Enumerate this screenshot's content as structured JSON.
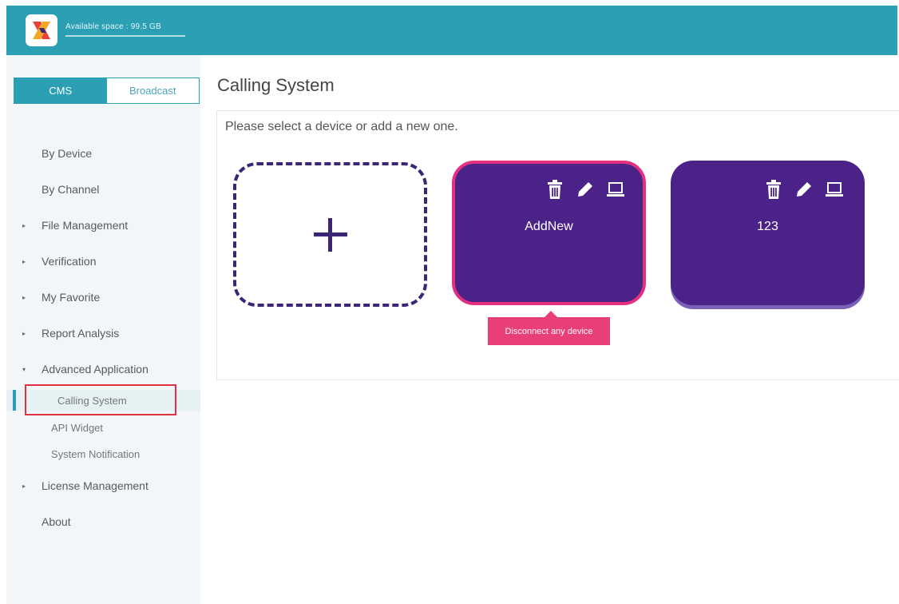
{
  "header": {
    "available_space": "Available space : 99.5 GB",
    "logo": "app-logo-icon",
    "colors": {
      "bar": "#2b9fb3"
    }
  },
  "sidebar": {
    "mode_tabs": [
      {
        "label": "CMS",
        "active": true
      },
      {
        "label": "Broadcast",
        "active": false
      }
    ],
    "items": [
      {
        "label": "By Device"
      },
      {
        "label": "By Channel"
      },
      {
        "label": "File Management",
        "icon": "caret-right-icon"
      },
      {
        "label": "Verification",
        "icon": "caret-right-icon"
      },
      {
        "label": "My Favorite",
        "icon": "caret-right-icon"
      },
      {
        "label": "Report Analysis",
        "icon": "caret-right-icon"
      },
      {
        "label": "Advanced Application",
        "icon": "caret-down-icon",
        "expanded": true
      },
      {
        "label": "License Management",
        "icon": "caret-right-icon"
      },
      {
        "label": "About"
      }
    ],
    "subitems": [
      {
        "label": "Calling System",
        "active": true
      },
      {
        "label": "API Widget"
      },
      {
        "label": "System Notification"
      }
    ],
    "caret_right": "▸",
    "caret_down": "▾"
  },
  "main": {
    "title": "Calling System",
    "instruction": "Please select a device or add a new one.",
    "add_card": {
      "icon": "plus-icon"
    },
    "devices": [
      {
        "name": "AddNew",
        "selected": true,
        "icons": [
          "trash-icon",
          "pencil-icon",
          "laptop-icon"
        ]
      },
      {
        "name": "123",
        "selected": false,
        "icons": [
          "trash-icon",
          "pencil-icon",
          "laptop-icon"
        ]
      }
    ],
    "tooltip": "Disconnect any device",
    "colors": {
      "card": "#4b2287",
      "selected_border": "#e3317f",
      "tooltip": "#e83f78"
    }
  }
}
